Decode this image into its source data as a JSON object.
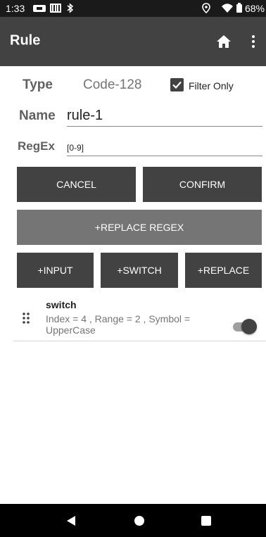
{
  "status_bar": {
    "time": "1:33",
    "battery": "68%"
  },
  "app_bar": {
    "title": "Rule",
    "icons": [
      "home-icon",
      "more-vert-icon"
    ]
  },
  "form": {
    "type_label": "Type",
    "type_value": "Code-128",
    "filter_only_label": "Filter Only",
    "filter_only_checked": true,
    "name_label": "Name",
    "name_value": "rule-1",
    "regex_label": "RegEx",
    "regex_value": "[0-9]"
  },
  "buttons": {
    "cancel": "CANCEL",
    "confirm": "CONFIRM",
    "replace_regex": "+REPLACE REGEX",
    "input": "+INPUT",
    "switch": "+SWITCH",
    "replace": "+REPLACE"
  },
  "rules": [
    {
      "title": "switch",
      "description": "Index = 4 , Range = 2 , Symbol = UpperCase",
      "enabled": true
    }
  ],
  "colors": {
    "app_bar": "#424242",
    "button": "#424242",
    "button_disabled": "#757575"
  }
}
